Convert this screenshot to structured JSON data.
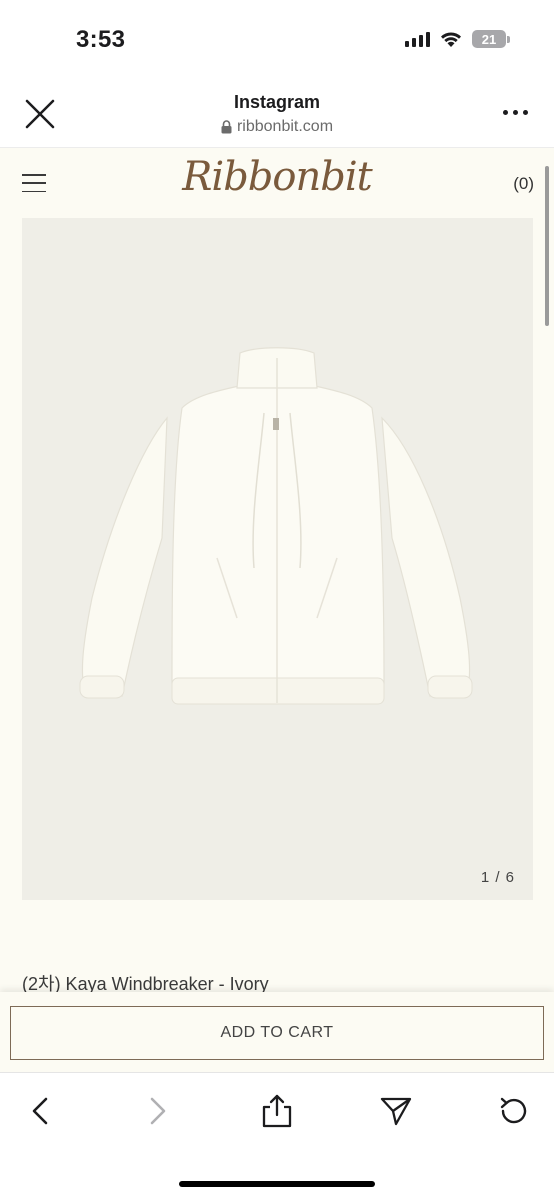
{
  "status_bar": {
    "time": "3:53",
    "battery_level": "21"
  },
  "browser": {
    "title": "Instagram",
    "url": "ribbonbit.com"
  },
  "site": {
    "logo": "Ribbonbit",
    "cart_count": "(0)",
    "image_counter": "1 / 6",
    "product_name": "(2차) Kaya Windbreaker - Ivory",
    "add_to_cart_label": "ADD TO CART"
  },
  "colors": {
    "site_bg": "#fcfbf3",
    "logo": "#7a5a3c",
    "button_border": "#7d6a56",
    "image_bg": "#efeee7"
  },
  "toolbar_icons": [
    "back-icon",
    "forward-icon",
    "share-icon",
    "send-icon",
    "reload-icon"
  ]
}
